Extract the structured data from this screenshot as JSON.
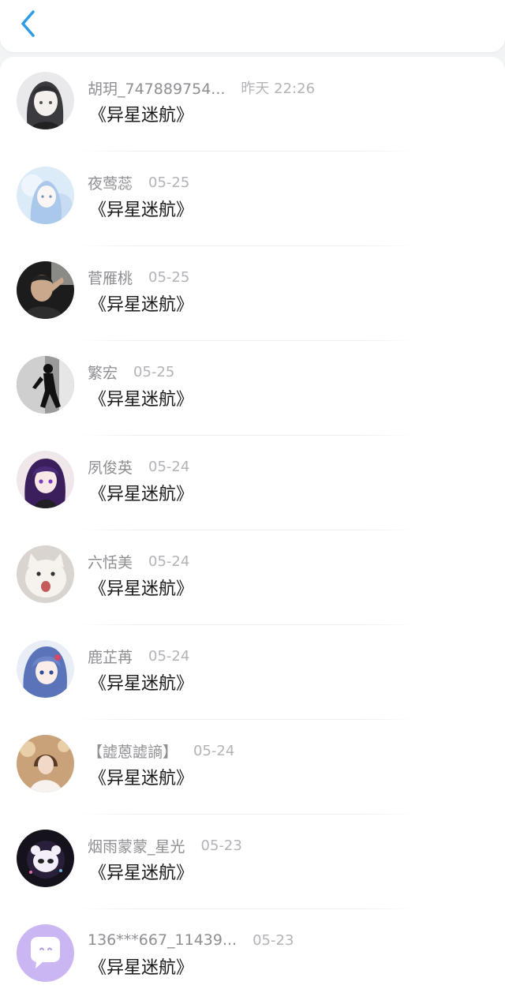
{
  "header": {
    "back_icon": "chevron-left-icon",
    "accent_color": "#2d9ce8"
  },
  "conversations": [
    {
      "name": "胡玥_747889754...",
      "time": "昨天 22:26",
      "message": "《异星迷航》",
      "avatar": "anime-girl-gray-hair"
    },
    {
      "name": "夜莺蕊",
      "time": "05-25",
      "message": "《异星迷航》",
      "avatar": "anime-girl-light-blue"
    },
    {
      "name": "菅雁桃",
      "time": "05-25",
      "message": "《异星迷航》",
      "avatar": "man-photo-dark"
    },
    {
      "name": "繁宏",
      "time": "05-25",
      "message": "《异星迷航》",
      "avatar": "person-silhouette-bw"
    },
    {
      "name": "夙俊英",
      "time": "05-24",
      "message": "《异星迷航》",
      "avatar": "anime-girl-purple-hair"
    },
    {
      "name": "六恬美",
      "time": "05-24",
      "message": "《异星迷航》",
      "avatar": "white-cat"
    },
    {
      "name": "鹿芷苒",
      "time": "05-24",
      "message": "《异星迷航》",
      "avatar": "anime-girl-blue-hair"
    },
    {
      "name": "【譃蒽譃謪】",
      "time": "05-24",
      "message": "《异星迷航》",
      "avatar": "girl-photo-warm"
    },
    {
      "name": "烟雨蒙蒙_星光",
      "time": "05-23",
      "message": "《异星迷航》",
      "avatar": "glowing-panda-dark"
    },
    {
      "name": "136***667_11439...",
      "time": "05-23",
      "message": "《异星迷航》",
      "avatar": "default-chat-bubble-purple"
    }
  ]
}
